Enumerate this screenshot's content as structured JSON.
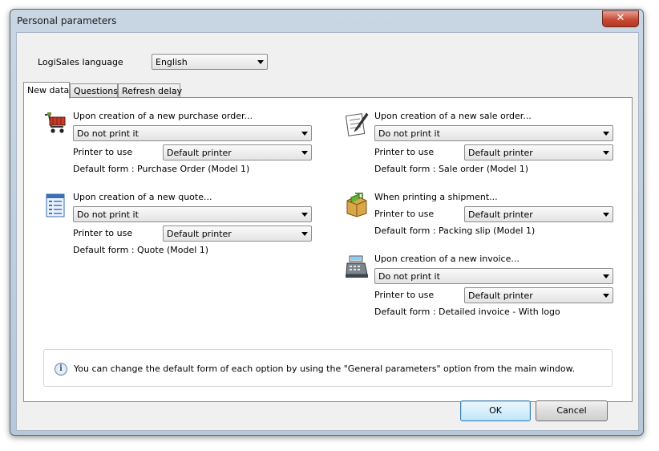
{
  "window": {
    "title": "Personal parameters",
    "close_glyph": "✕"
  },
  "language": {
    "label": "LogiSales language",
    "value": "English"
  },
  "tabs": [
    {
      "label": "New data",
      "active": true
    },
    {
      "label": "Questions",
      "active": false
    },
    {
      "label": "Refresh delay",
      "active": false
    }
  ],
  "sections": {
    "purchase": {
      "icon": "shopping-cart-icon",
      "heading": "Upon creation of a new purchase order...",
      "action": "Do not print it",
      "printer_label": "Printer to use",
      "printer": "Default printer",
      "form": "Default form : Purchase Order (Model 1)"
    },
    "quote": {
      "icon": "quote-document-icon",
      "heading": "Upon creation of a new quote...",
      "action": "Do not print it",
      "printer_label": "Printer to use",
      "printer": "Default printer",
      "form": "Default form : Quote (Model 1)"
    },
    "sale": {
      "icon": "sale-order-icon",
      "heading": "Upon creation of a new sale order...",
      "action": "Do not print it",
      "printer_label": "Printer to use",
      "printer": "Default printer",
      "form": "Default form : Sale order (Model 1)"
    },
    "shipment": {
      "icon": "shipment-box-icon",
      "heading": "When printing a shipment...",
      "printer_label": "Printer to use",
      "printer": "Default printer",
      "form": "Default form : Packing slip (Model 1)"
    },
    "invoice": {
      "icon": "cash-register-icon",
      "heading": "Upon creation of a new invoice...",
      "action": "Do not print it",
      "printer_label": "Printer to use",
      "printer": "Default printer",
      "form": "Default form : Detailed invoice - With logo"
    }
  },
  "info": {
    "icon": "info-icon",
    "glyph": "i",
    "text": "You can change the default form of each option by using the \"General parameters\" option from the main window."
  },
  "buttons": {
    "ok": "OK",
    "cancel": "Cancel"
  }
}
